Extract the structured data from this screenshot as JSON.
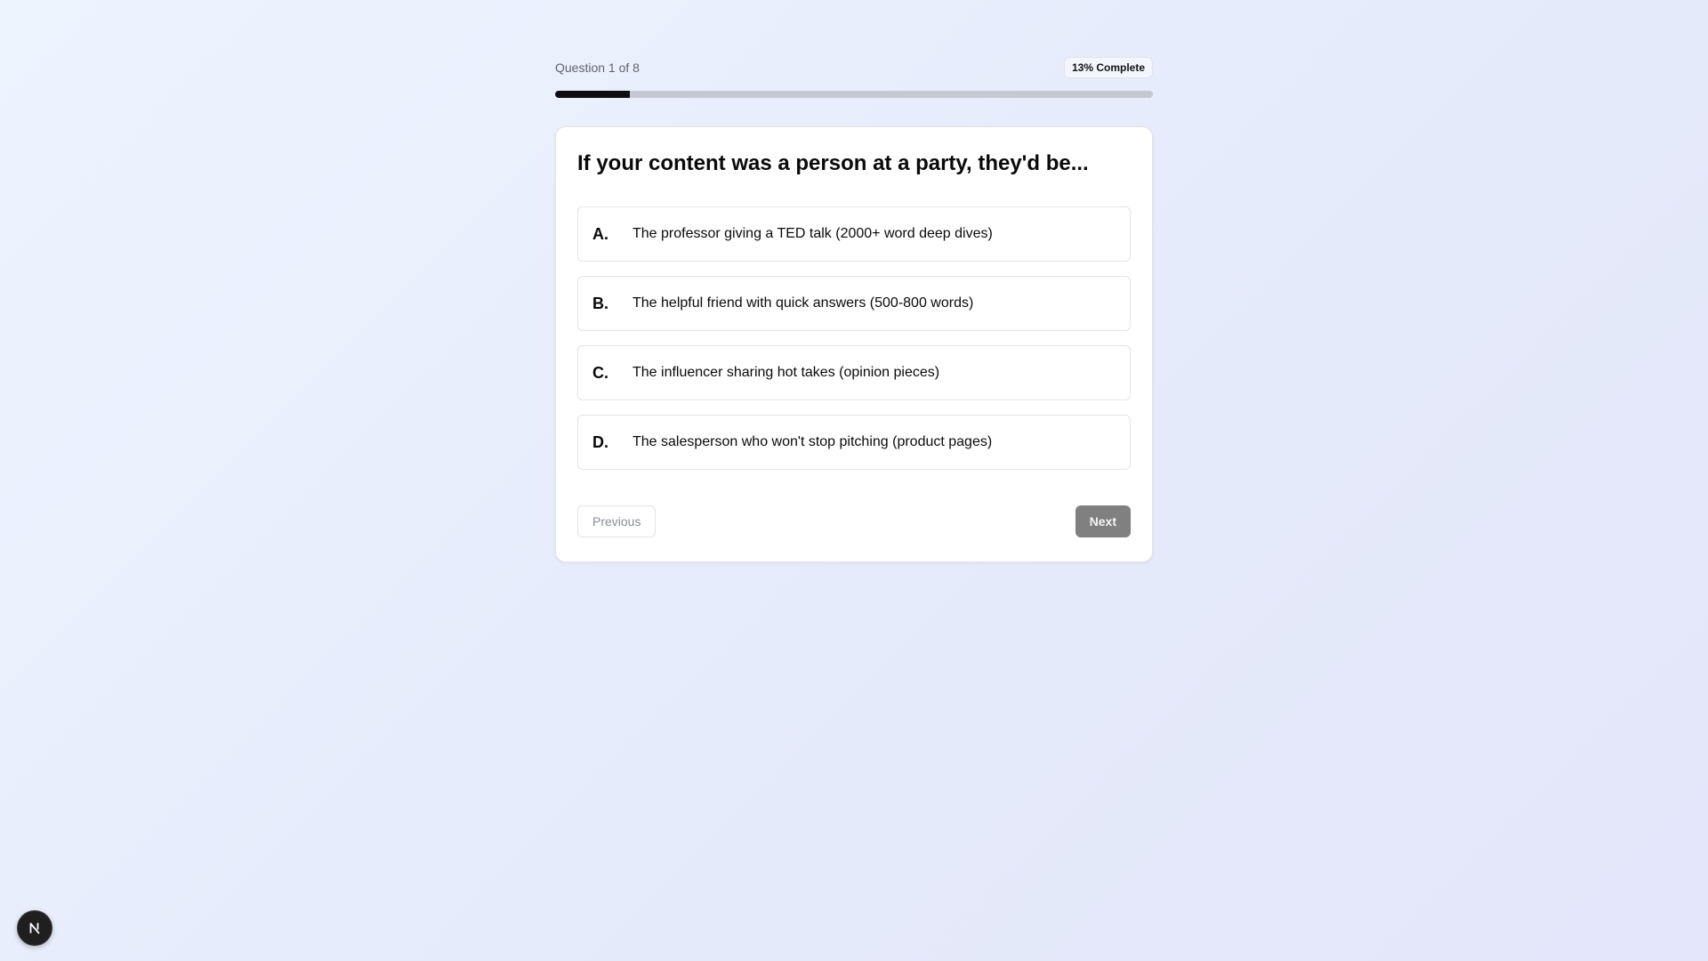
{
  "quiz": {
    "question_counter": "Question 1 of 8",
    "completion_badge": "13% Complete",
    "progress_fraction": 0.125,
    "question": "If your content was a person at a party, they'd be...",
    "options": [
      {
        "letter": "A.",
        "text": "The professor giving a TED talk (2000+ word deep dives)"
      },
      {
        "letter": "B.",
        "text": "The helpful friend with quick answers (500-800 words)"
      },
      {
        "letter": "C.",
        "text": "The influencer sharing hot takes (opinion pieces)"
      },
      {
        "letter": "D.",
        "text": "The salesperson who won't stop pitching (product pages)"
      }
    ],
    "previous_label": "Previous",
    "next_label": "Next"
  },
  "dev_indicator": {
    "icon": "nextjs-logo-icon",
    "letter": "N"
  },
  "colors": {
    "progress_fill": "#0e0e10",
    "progress_track": "#c4c8d2",
    "next_button": "#808080"
  }
}
